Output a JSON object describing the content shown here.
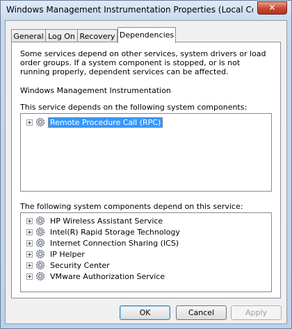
{
  "window": {
    "title": "Windows Management Instrumentation Properties (Local Compu...",
    "close_glyph": "✕"
  },
  "tabs": [
    {
      "label": "General"
    },
    {
      "label": "Log On"
    },
    {
      "label": "Recovery"
    },
    {
      "label": "Dependencies"
    }
  ],
  "active_tab": "Dependencies",
  "dependencies": {
    "description": "Some services depend on other services, system drivers or load order groups. If a system component is stopped, or is not running properly, dependent services can be affected.",
    "service_name": "Windows Management Instrumentation",
    "depends_on_label": "This service depends on the following system components:",
    "depends_on": [
      {
        "label": "Remote Procedure Call (RPC)",
        "selected": true
      }
    ],
    "dependents_label": "The following system components depend on this service:",
    "dependents": [
      {
        "label": "HP Wireless Assistant Service"
      },
      {
        "label": "Intel(R) Rapid Storage Technology"
      },
      {
        "label": "Internet Connection Sharing (ICS)"
      },
      {
        "label": "IP Helper"
      },
      {
        "label": "Security Center"
      },
      {
        "label": "VMware Authorization Service"
      }
    ]
  },
  "buttons": {
    "ok": "OK",
    "cancel": "Cancel",
    "apply": "Apply"
  },
  "colors": {
    "selection": "#3399ff",
    "window_frame": "#c6d9ef",
    "close_button": "#c7462e"
  }
}
